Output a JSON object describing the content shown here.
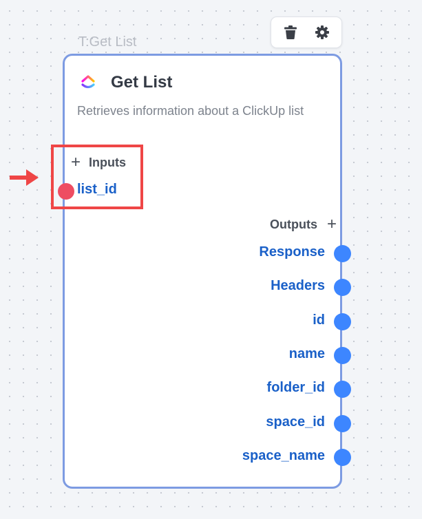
{
  "node": {
    "tag": "T:Get List",
    "title": "Get List",
    "description": "Retrieves information about a ClickUp list",
    "inputs_label": "Inputs",
    "outputs_label": "Outputs",
    "add_symbol": "+",
    "inputs": [
      {
        "label": "list_id"
      }
    ],
    "outputs": [
      {
        "label": "Response"
      },
      {
        "label": "Headers"
      },
      {
        "label": "id"
      },
      {
        "label": "name"
      },
      {
        "label": "folder_id"
      },
      {
        "label": "space_id"
      },
      {
        "label": "space_name"
      }
    ]
  },
  "toolbar": {
    "icons": [
      "trash-icon",
      "gear-icon"
    ]
  },
  "annotations": {
    "highlight": "red-box",
    "pointer": "red-arrow-right"
  },
  "colors": {
    "node_border": "#7d9be2",
    "port_label": "#1a60c8",
    "output_port": "#3d86ff",
    "input_port": "#ee4d62",
    "annotation": "#ef4646"
  }
}
